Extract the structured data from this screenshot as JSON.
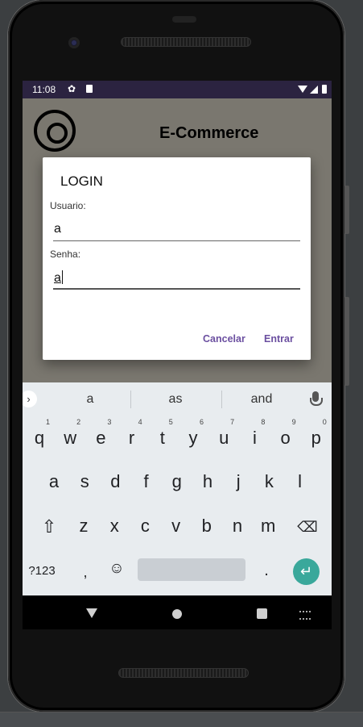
{
  "status_bar": {
    "time": "11:08"
  },
  "app": {
    "title": "E-Commerce"
  },
  "dialog": {
    "title": "LOGIN",
    "user_label": "Usuario:",
    "user_value": "a",
    "pass_label": "Senha:",
    "pass_value": "a",
    "cancel_label": "Cancelar",
    "ok_label": "Entrar"
  },
  "keyboard": {
    "suggestions": [
      "a",
      "as",
      "and"
    ],
    "row1": [
      {
        "k": "q",
        "h": "1"
      },
      {
        "k": "w",
        "h": "2"
      },
      {
        "k": "e",
        "h": "3"
      },
      {
        "k": "r",
        "h": "4"
      },
      {
        "k": "t",
        "h": "5"
      },
      {
        "k": "y",
        "h": "6"
      },
      {
        "k": "u",
        "h": "7"
      },
      {
        "k": "i",
        "h": "8"
      },
      {
        "k": "o",
        "h": "9"
      },
      {
        "k": "p",
        "h": "0"
      }
    ],
    "row2": [
      "a",
      "s",
      "d",
      "f",
      "g",
      "h",
      "j",
      "k",
      "l"
    ],
    "row3": [
      "z",
      "x",
      "c",
      "v",
      "b",
      "n",
      "m"
    ],
    "symbols_label": "?123",
    "comma": ",",
    "period": "."
  },
  "colors": {
    "accent": "#6b4fa0",
    "enter": "#3aa89b",
    "statusbar": "#2b2340",
    "app_bg": "#7a776f"
  }
}
